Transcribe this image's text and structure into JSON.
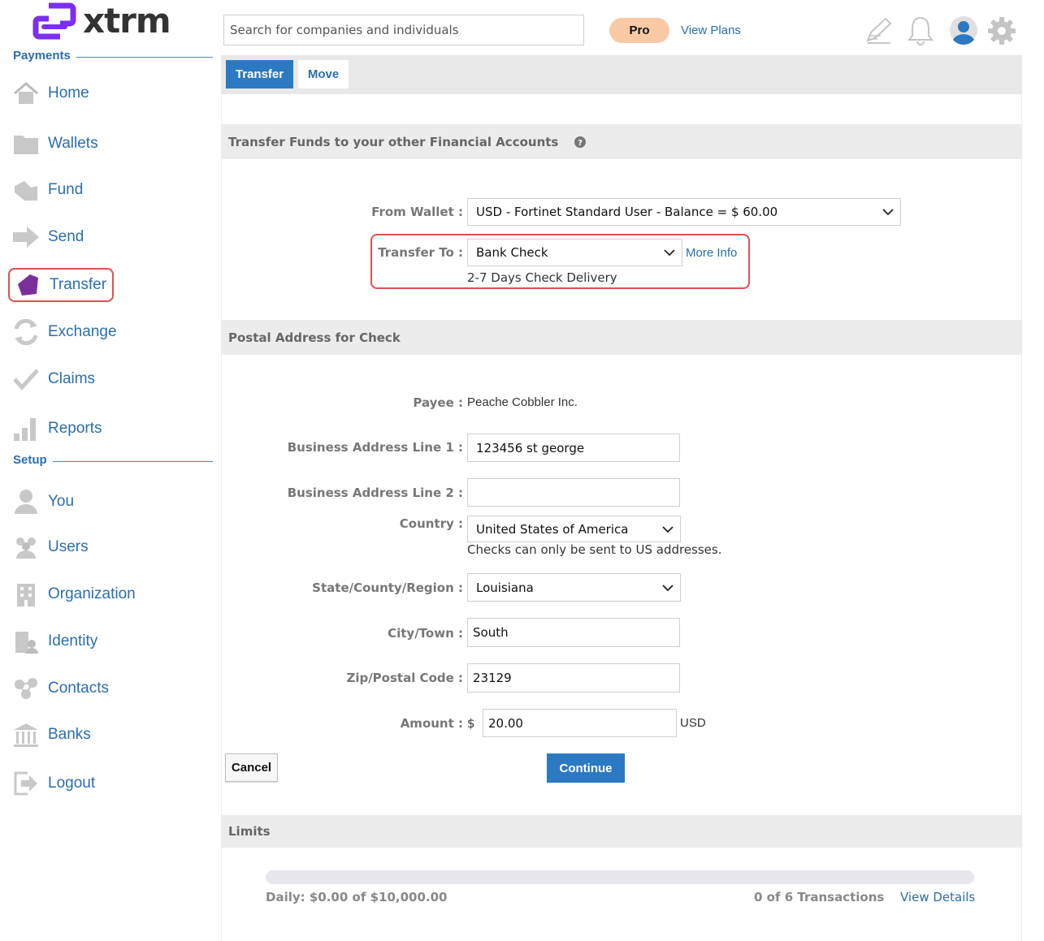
{
  "app": {
    "logo_text": "xtrm"
  },
  "sidebar": {
    "payments_label": "Payments",
    "setup_label": "Setup",
    "payments_items": [
      {
        "label": "Home",
        "icon": "home-icon"
      },
      {
        "label": "Wallets",
        "icon": "folder-icon"
      },
      {
        "label": "Fund",
        "icon": "fund-icon"
      },
      {
        "label": "Send",
        "icon": "send-arrow-icon"
      },
      {
        "label": "Transfer",
        "icon": "transfer-icon",
        "active": true
      },
      {
        "label": "Exchange",
        "icon": "exchange-icon"
      },
      {
        "label": "Claims",
        "icon": "checkmark-icon"
      },
      {
        "label": "Reports",
        "icon": "bar-chart-icon"
      }
    ],
    "setup_items": [
      {
        "label": "You",
        "icon": "user-icon"
      },
      {
        "label": "Users",
        "icon": "users-icon"
      },
      {
        "label": "Organization",
        "icon": "building-icon"
      },
      {
        "label": "Identity",
        "icon": "identity-icon"
      },
      {
        "label": "Contacts",
        "icon": "contacts-icon"
      },
      {
        "label": "Banks",
        "icon": "bank-icon"
      },
      {
        "label": "Logout",
        "icon": "logout-icon"
      }
    ]
  },
  "header": {
    "search_placeholder": "Search for companies and individuals",
    "pro_label": "Pro",
    "view_plans": "View Plans",
    "icons": [
      "edit-icon",
      "bell-icon",
      "account-icon",
      "gear-icon"
    ]
  },
  "tabs": {
    "transfer": "Transfer",
    "move": "Move"
  },
  "transfer_section": {
    "title": "Transfer Funds to your other Financial Accounts",
    "from_wallet_label": "From Wallet :",
    "from_wallet_value": "USD - Fortinet Standard User - Balance = $ 60.00",
    "transfer_to_label": "Transfer To :",
    "transfer_to_value": "Bank Check",
    "more_info": "More Info",
    "delivery_note": "2-7 Days Check Delivery"
  },
  "postal_section": {
    "title": "Postal Address for Check",
    "payee_label": "Payee :",
    "payee_value": "Peache Cobbler Inc.",
    "address1_label": "Business Address Line 1 :",
    "address1_value": "123456 st george",
    "address2_label": "Business Address Line 2 :",
    "address2_value": "",
    "country_label": "Country :",
    "country_value": "United States of America",
    "country_note": "Checks can only be sent to US addresses.",
    "state_label": "State/County/Region :",
    "state_value": "Louisiana",
    "city_label": "City/Town :",
    "city_value": "South",
    "zip_label": "Zip/Postal Code :",
    "zip_value": "23129",
    "amount_label": "Amount :",
    "currency_symbol": "$",
    "amount_value": "20.00",
    "currency_code": "USD"
  },
  "actions": {
    "cancel": "Cancel",
    "continue": "Continue"
  },
  "limits": {
    "title": "Limits",
    "daily": "Daily: $0.00 of $10,000.00",
    "daily_used_fraction": 0.0,
    "transactions": "0 of 6 Transactions",
    "view_details": "View Details"
  },
  "colors": {
    "accent": "#2b79c2",
    "link": "#2a6eb0",
    "highlight": "#d9534f",
    "logo_purple": "#7b2ff2",
    "pro_badge": "#f9c9a6"
  }
}
